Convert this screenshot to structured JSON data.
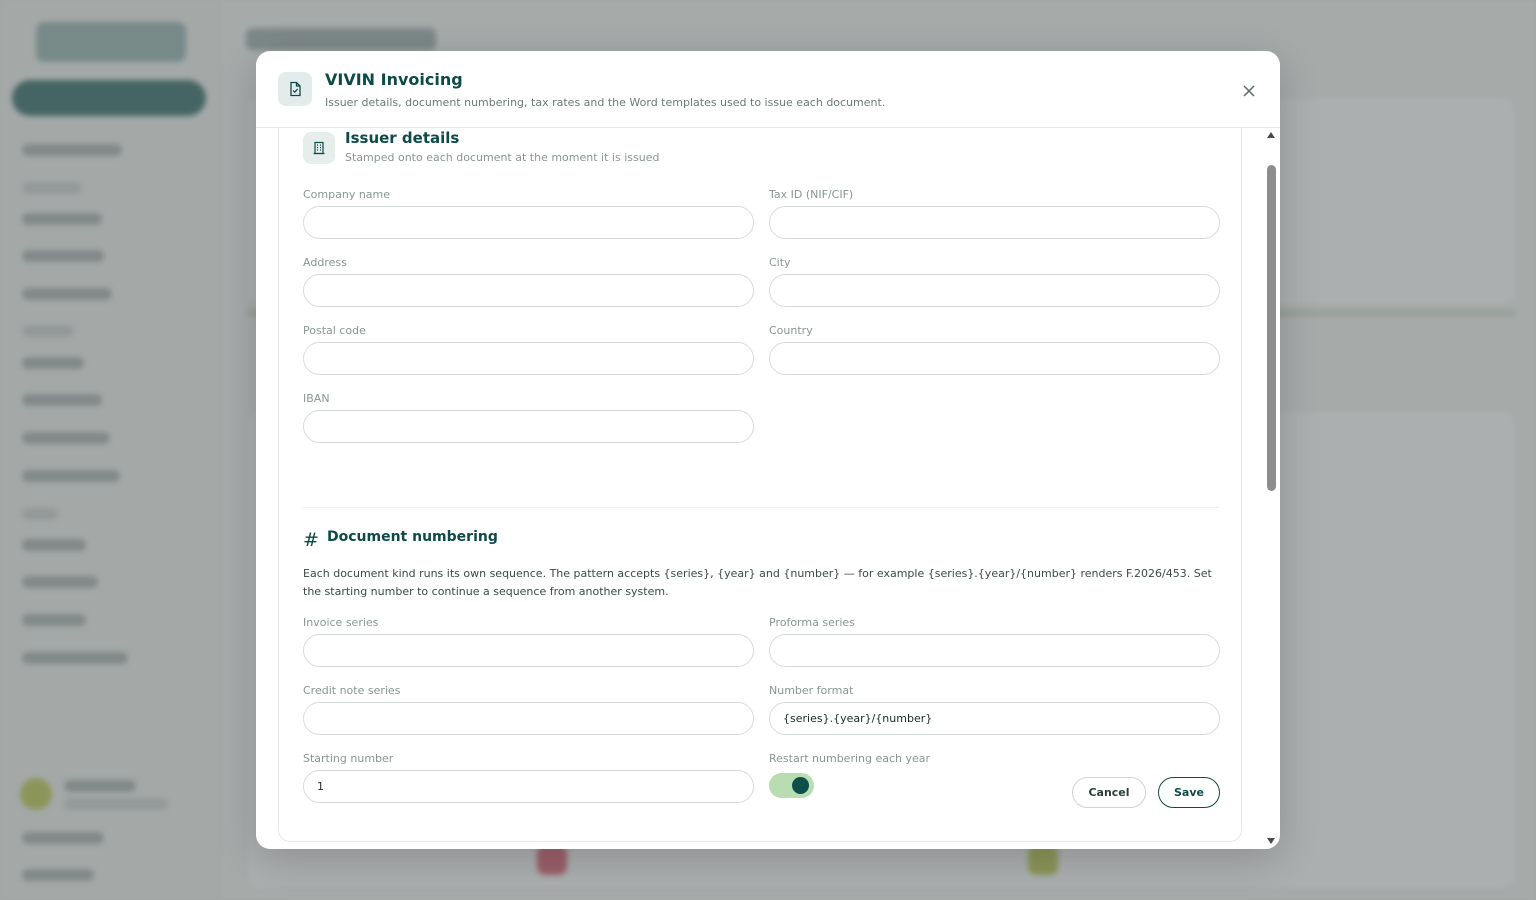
{
  "modal": {
    "title": "VIVIN Invoicing",
    "subtitle": "Issuer details, document numbering, tax rates and the Word templates used to issue each document.",
    "icon": "document-check-icon",
    "close_icon": "close-icon"
  },
  "issuer": {
    "title": "Issuer details",
    "subtitle": "Stamped onto each document at the moment it is issued",
    "icon": "building-icon",
    "fields": {
      "company_name": {
        "label": "Company name",
        "value": ""
      },
      "tax_id": {
        "label": "Tax ID (NIF/CIF)",
        "value": ""
      },
      "address": {
        "label": "Address",
        "value": ""
      },
      "city": {
        "label": "City",
        "value": ""
      },
      "postal_code": {
        "label": "Postal code",
        "value": ""
      },
      "country": {
        "label": "Country",
        "value": ""
      },
      "iban": {
        "label": "IBAN",
        "value": ""
      }
    }
  },
  "numbering": {
    "title": "Document numbering",
    "icon": "hash-icon",
    "description": "Each document kind runs its own sequence. The pattern accepts {series}, {year} and {number} — for example {series}.{year}/{number} renders F.2026/453. Set the starting number to continue a sequence from another system.",
    "fields": {
      "invoice_series": {
        "label": "Invoice series",
        "value": ""
      },
      "proforma_series": {
        "label": "Proforma series",
        "value": ""
      },
      "credit_note_series": {
        "label": "Credit note series",
        "value": ""
      },
      "number_format": {
        "label": "Number format",
        "value": "{series}.{year}/{number}"
      },
      "starting_number": {
        "label": "Starting number",
        "value": "1"
      }
    },
    "restart_each_year": {
      "label": "Restart numbering each year",
      "enabled": true
    }
  },
  "actions": {
    "cancel": "Cancel",
    "save": "Save"
  },
  "colors": {
    "accent": "#0d4a48",
    "toggle_track": "#b8ddb0",
    "overlay": "#6e7675"
  }
}
